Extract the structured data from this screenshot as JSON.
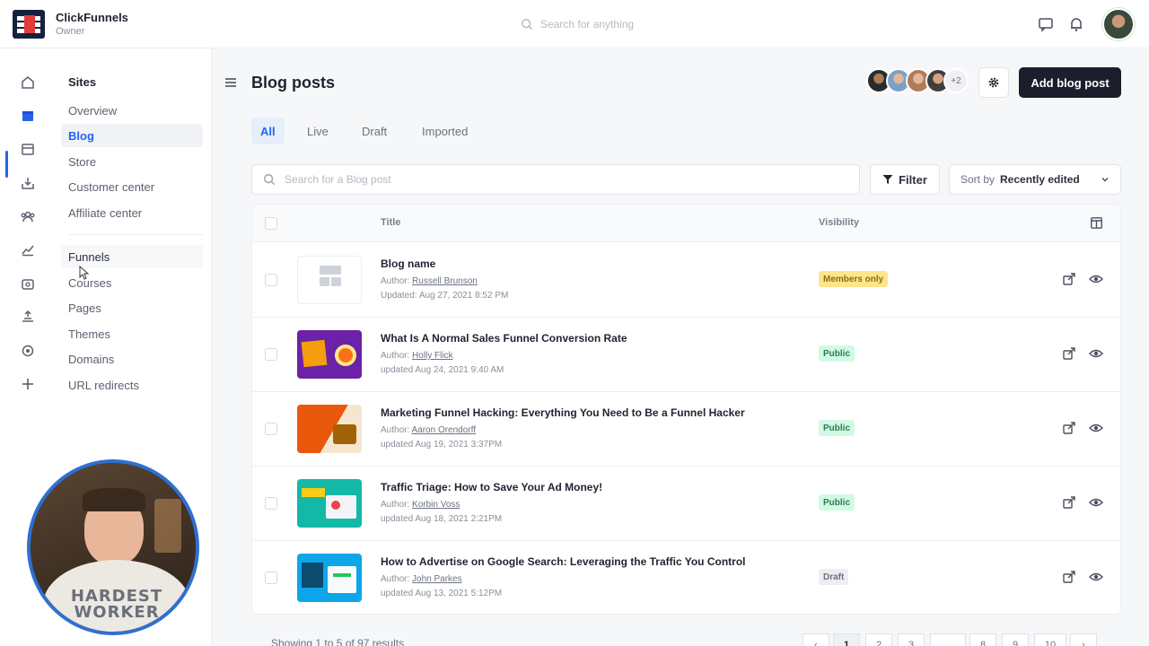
{
  "app": {
    "brand_name": "ClickFunnels",
    "user_role": "Owner",
    "search_placeholder": "Search for anything"
  },
  "rail_icons": [
    "home-icon",
    "sites-icon",
    "store-icon",
    "inbox-icon",
    "contacts-icon",
    "analytics-icon",
    "automation-icon",
    "payments-icon",
    "settings-icon",
    "add-icon"
  ],
  "subnav": {
    "section_title": "Sites",
    "group1": [
      "Overview",
      "Blog",
      "Store",
      "Customer center",
      "Affiliate center"
    ],
    "group2": [
      "Funnels",
      "Courses",
      "Pages",
      "Themes",
      "Domains",
      "URL redirects"
    ],
    "active_item": "Blog"
  },
  "page": {
    "title": "Blog posts",
    "team_more": "+2",
    "add_button": "Add blog post",
    "tabs": [
      "All",
      "Live",
      "Draft",
      "Imported"
    ],
    "active_tab": "All",
    "search_placeholder": "Search for a Blog post",
    "filter_label": "Filter",
    "sort_prefix": "Sort by",
    "sort_value": "Recently edited"
  },
  "table": {
    "col_title": "Title",
    "col_visibility": "Visibility",
    "author_label": "Author:",
    "rows": [
      {
        "title": "Blog name",
        "author": "Russell Brunson",
        "updated": "Updated: Aug 27, 2021 8:52 PM",
        "visibility": "Members only"
      },
      {
        "title": "What Is A Normal Sales Funnel Conversion Rate",
        "author": "Holly Flick",
        "updated": "updated Aug 24, 2021 9:40 AM",
        "visibility": "Public"
      },
      {
        "title": "Marketing Funnel Hacking: Everything You Need to Be a Funnel Hacker",
        "author": "Aaron Orendorff",
        "updated": "updated Aug 19, 2021 3:37PM",
        "visibility": "Public"
      },
      {
        "title": "Traffic Triage: How to Save Your Ad Money!",
        "author": "Korbin Voss",
        "updated": "updated Aug 18, 2021 2:21PM",
        "visibility": "Public"
      },
      {
        "title": "How to Advertise on Google Search: Leveraging the Traffic You Control",
        "author": "John Parkes",
        "updated": "updated Aug 13, 2021 5:12PM",
        "visibility": "Draft"
      }
    ]
  },
  "footer": {
    "results_text": "Showing 1 to 5 of 97 results",
    "pages": [
      "‹",
      "1",
      "2",
      "3",
      "…",
      "8",
      "9",
      "10",
      "›"
    ]
  },
  "colors": {
    "accent": "#2563eb",
    "members_badge_bg": "#fde68a",
    "public_badge_bg": "#d1fae5",
    "draft_badge_bg": "#eceef1",
    "primary_button": "#1a1f2b"
  },
  "webcam_shirt_text": "HARDEST WORKER"
}
